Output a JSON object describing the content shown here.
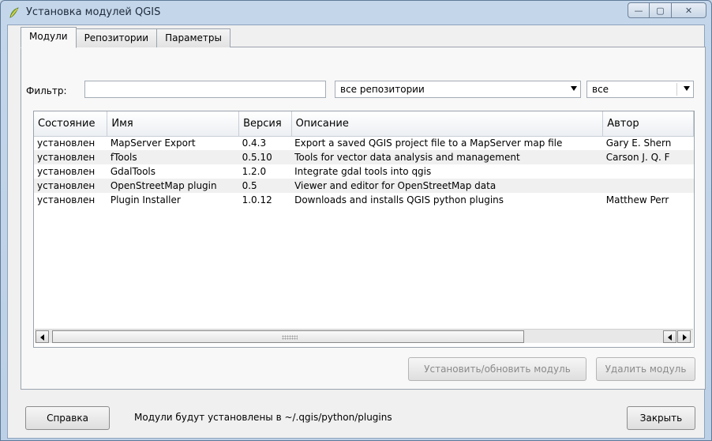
{
  "window": {
    "title": "Установка модулей QGIS",
    "controls": {
      "minimize": "—",
      "maximize": "▢",
      "close": "✕"
    }
  },
  "tabs": [
    "Модули",
    "Репозитории",
    "Параметры"
  ],
  "filter": {
    "label": "Фильтр:",
    "value": "",
    "repo_select": "все репозитории",
    "status_select": "все"
  },
  "table": {
    "columns": [
      "Состояние",
      "Имя",
      "Версия",
      "Описание",
      "Автор"
    ],
    "rows": [
      [
        "установлен",
        "MapServer Export",
        "0.4.3",
        "Export a saved QGIS project file to a MapServer map file",
        "Gary E. Shern"
      ],
      [
        "установлен",
        "fTools",
        "0.5.10",
        "Tools for vector data analysis and management",
        "Carson J. Q. F"
      ],
      [
        "установлен",
        "GdalTools",
        "1.2.0",
        "Integrate gdal tools into qgis",
        ""
      ],
      [
        "установлен",
        "OpenStreetMap plugin",
        "0.5",
        "Viewer and editor for OpenStreetMap data",
        ""
      ],
      [
        "установлен",
        "Plugin Installer",
        "1.0.12",
        "Downloads and installs QGIS python plugins",
        "Matthew Perr"
      ]
    ]
  },
  "actions": {
    "install": "Установить/обновить модуль",
    "uninstall": "Удалить модуль"
  },
  "footer": {
    "help": "Справка",
    "path_info": "Модули будут установлены в ~/.qgis/python/plugins",
    "close": "Закрыть"
  },
  "colors": {
    "accent": "#c4d6ea",
    "alt_row": "#f0f0f0"
  }
}
